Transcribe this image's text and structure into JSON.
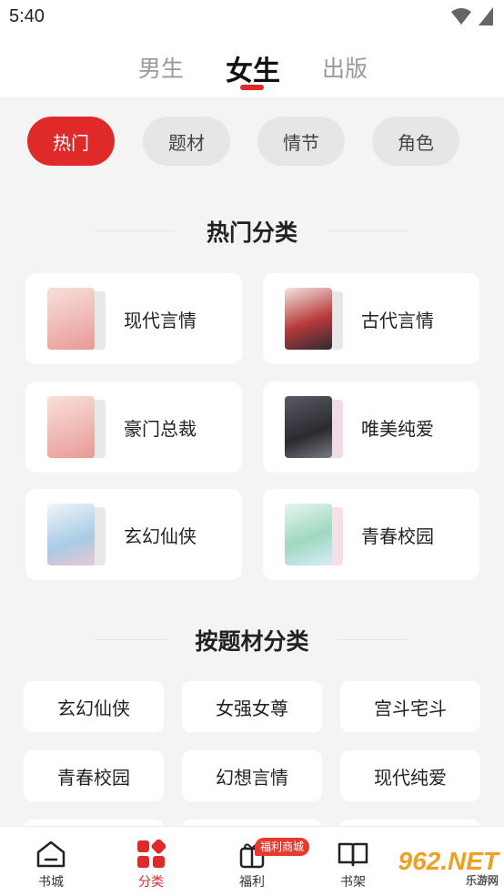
{
  "status": {
    "time": "5:40"
  },
  "top_tabs": [
    {
      "label": "男生"
    },
    {
      "label": "女生",
      "active": true
    },
    {
      "label": "出版"
    }
  ],
  "filter_chips": [
    {
      "label": "热门",
      "active": true
    },
    {
      "label": "题材"
    },
    {
      "label": "情节"
    },
    {
      "label": "角色"
    }
  ],
  "hot_section": {
    "title": "热门分类",
    "categories": [
      {
        "label": "现代言情",
        "cover_color": "#f4d3cf"
      },
      {
        "label": "古代言情",
        "cover_color": "#b83a3a"
      },
      {
        "label": "豪门总裁",
        "cover_color": "#f2cfcb"
      },
      {
        "label": "唯美纯爱",
        "cover_color": "#3b3b44"
      },
      {
        "label": "玄幻仙侠",
        "cover_color": "#cfe3f1"
      },
      {
        "label": "青春校园",
        "cover_color": "#9fd8c0"
      }
    ]
  },
  "theme_section": {
    "title": "按题材分类",
    "tags": [
      "玄幻仙侠",
      "女强女尊",
      "宫斗宅斗",
      "青春校园",
      "幻想言情",
      "现代纯爱"
    ]
  },
  "bottom_nav": {
    "items": [
      {
        "label": "书城",
        "icon": "home-icon"
      },
      {
        "label": "分类",
        "icon": "category-icon",
        "active": true
      },
      {
        "label": "福利",
        "icon": "gift-icon"
      },
      {
        "label": "书架",
        "icon": "bookshelf-icon"
      }
    ],
    "promo_badge": "福利商城"
  },
  "watermark": {
    "main": "962.NET",
    "sub": "乐游网"
  },
  "colors": {
    "accent": "#e02a2a",
    "background": "#f4f4f4"
  }
}
